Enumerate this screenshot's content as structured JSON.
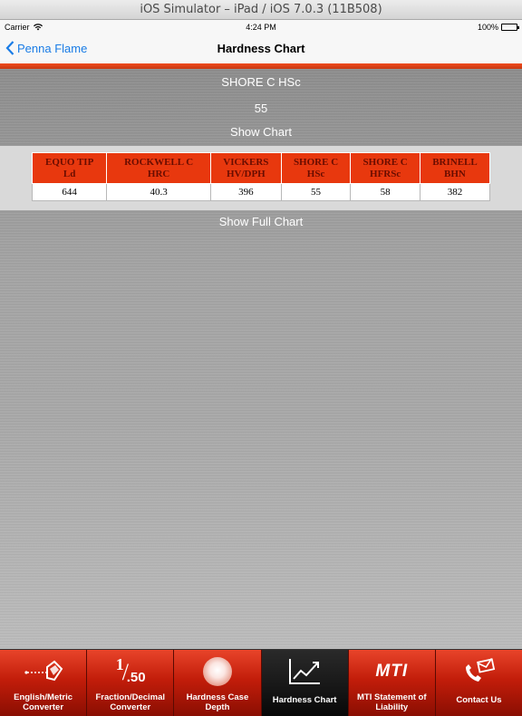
{
  "window": {
    "title": "iOS Simulator – iPad / iOS 7.0.3 (11B508)"
  },
  "status_bar": {
    "carrier": "Carrier",
    "time": "4:24 PM",
    "battery": "100%"
  },
  "nav": {
    "back_label": "Penna Flame",
    "title": "Hardness Chart"
  },
  "converter": {
    "scale_label": "SHORE C HSc",
    "value": "55",
    "show_chart_label": "Show  Chart",
    "show_full_chart_label": "Show Full Chart"
  },
  "table": {
    "columns": [
      {
        "line1": "EQUO TIP",
        "line2": "Ld"
      },
      {
        "line1": "ROCKWELL C",
        "line2": "HRC"
      },
      {
        "line1": "VICKERS",
        "line2": "HV/DPH"
      },
      {
        "line1": "SHORE C",
        "line2": "HSc"
      },
      {
        "line1": "SHORE C",
        "line2": "HFRSc"
      },
      {
        "line1": "BRINELL",
        "line2": "BHN"
      }
    ],
    "rows": [
      [
        "644",
        "40.3",
        "396",
        "55",
        "58",
        "382"
      ]
    ]
  },
  "tabs": [
    {
      "icon": "ruler-measure-icon",
      "line1": "English/Metric",
      "line2": "Converter",
      "active": false
    },
    {
      "icon": "fraction-icon",
      "line1": "Fraction/Decimal",
      "line2": "Converter",
      "frac_num": "1",
      "frac_den": ".50",
      "active": false
    },
    {
      "icon": "glow-orb-icon",
      "line1": "Hardness Case",
      "line2": "Depth",
      "active": false
    },
    {
      "icon": "line-chart-icon",
      "line1": "Hardness Chart",
      "line2": "",
      "active": true
    },
    {
      "icon": "mti-logo-icon",
      "logo_text": "MTI",
      "line1": "MTI Statement of",
      "line2": "Liability",
      "active": false
    },
    {
      "icon": "phone-mail-icon",
      "line1": "Contact Us",
      "line2": "",
      "active": false
    }
  ],
  "colors": {
    "accent_red": "#e8380e",
    "ios_blue": "#1a7ce6",
    "tab_active": "#0a0a0a"
  }
}
